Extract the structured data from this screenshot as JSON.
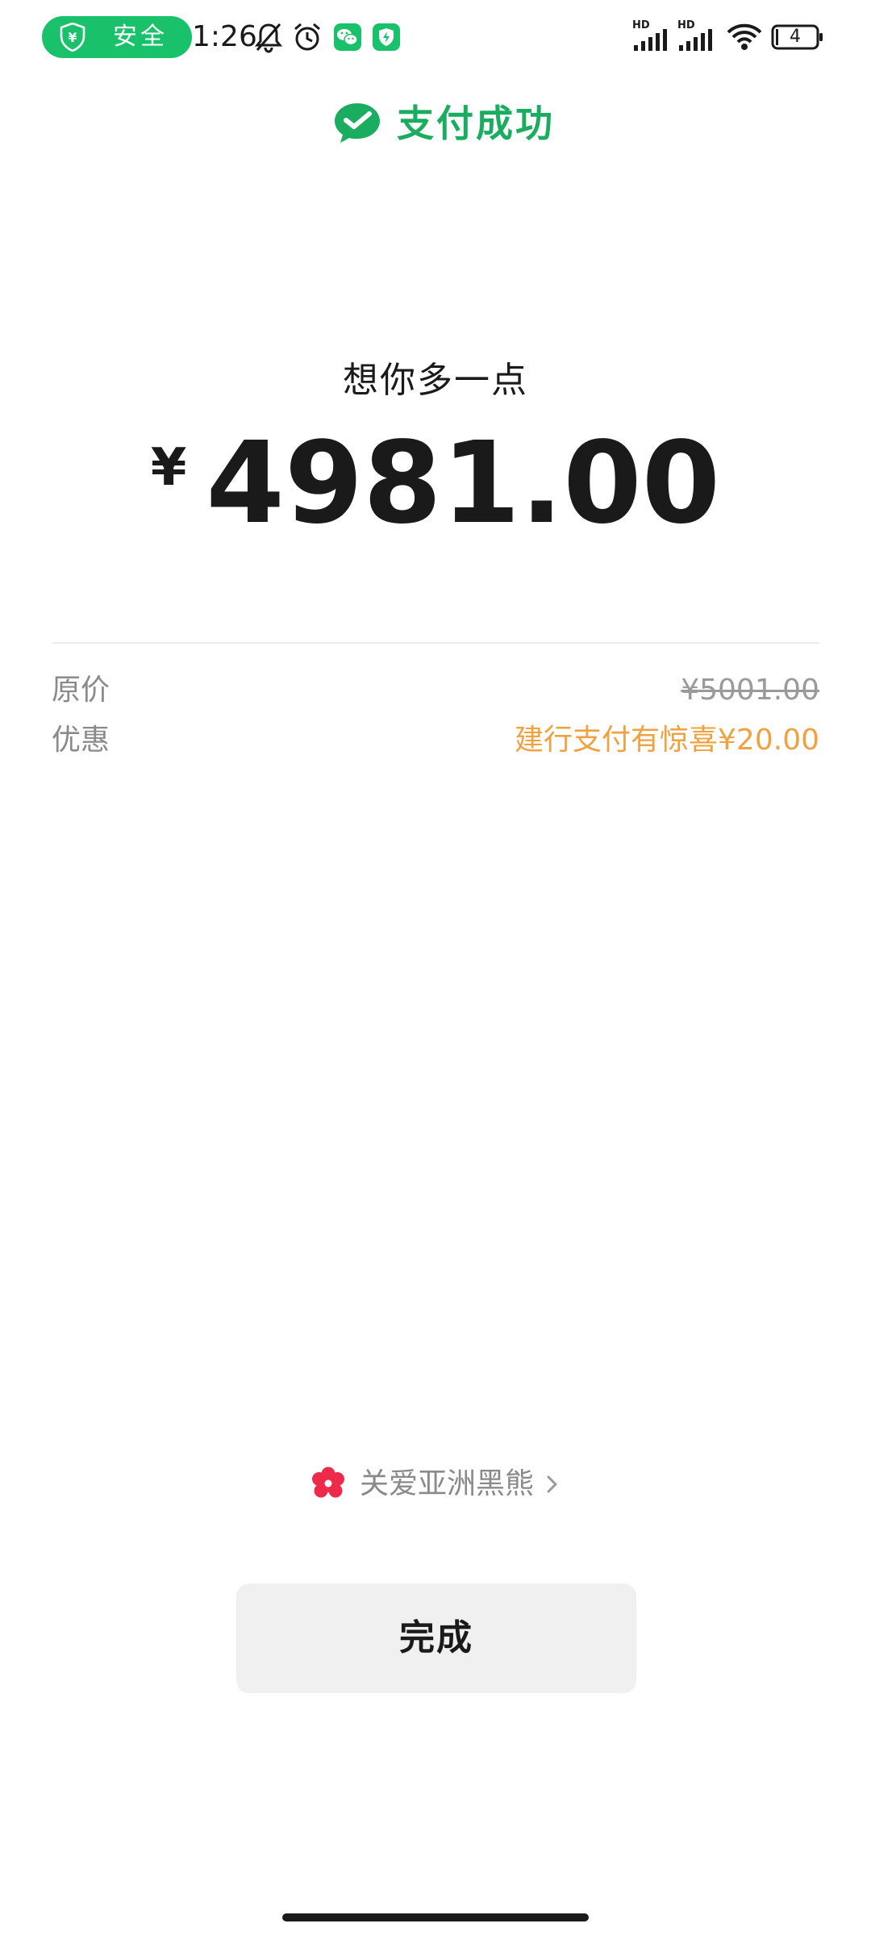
{
  "status_bar": {
    "security_label": "安全",
    "time": "1:26",
    "icons": [
      "shield-yen-icon",
      "bell-off-icon",
      "alarm-icon",
      "wechat-icon",
      "security-app-icon",
      "signal-hd-icon",
      "signal-hd-icon",
      "wifi-icon",
      "battery-icon"
    ],
    "signal_badge_1": "HD",
    "signal_badge_2": "HD",
    "battery_level": "4"
  },
  "header": {
    "title": "支付成功",
    "icon": "wechat-pay-check-icon"
  },
  "payment": {
    "merchant": "想你多一点",
    "currency_symbol": "¥",
    "amount": "4981.00"
  },
  "details": [
    {
      "label": "原价",
      "value": "¥5001.00"
    },
    {
      "label": "优惠",
      "value": "建行支付有惊喜¥20.00"
    }
  ],
  "charity": {
    "icon": "flower-icon",
    "text": "关爱亚洲黑熊"
  },
  "done_button": {
    "label": "完成"
  },
  "colors": {
    "accent_green": "#1aad60",
    "security_pill": "#1ac16b",
    "discount_orange": "#f0a140",
    "muted_text": "#8a8a8a",
    "flower_red": "#ee2a4a",
    "button_bg": "#f0f0f0"
  }
}
